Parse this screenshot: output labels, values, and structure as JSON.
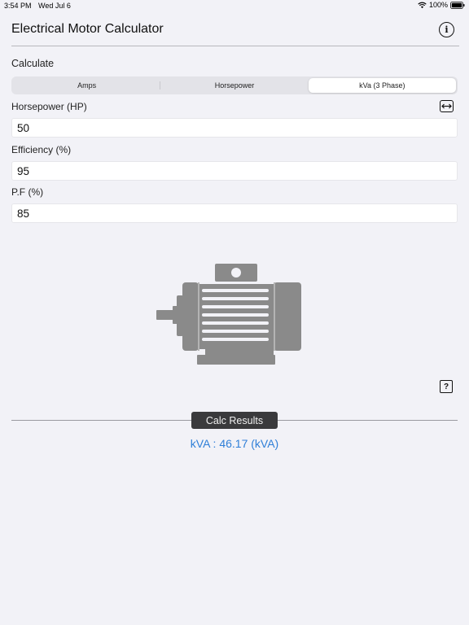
{
  "status_bar": {
    "time": "3:54 PM",
    "date": "Wed Jul 6",
    "battery": "100%"
  },
  "nav": {
    "title": "Electrical Motor Calculator",
    "info_icon": "info-circle-icon"
  },
  "calculate": {
    "label": "Calculate",
    "segments": [
      {
        "label": "Amps",
        "selected": false
      },
      {
        "label": "Horsepower",
        "selected": false
      },
      {
        "label": "kVa (3 Phase)",
        "selected": true
      }
    ]
  },
  "fields": {
    "horsepower": {
      "label": "Horsepower (HP)",
      "value": "50"
    },
    "efficiency": {
      "label": "Efficiency (%)",
      "value": "95"
    },
    "pf": {
      "label": "P.F (%)",
      "value": "85"
    }
  },
  "icons": {
    "swap": "swap-horizontal-icon",
    "help": "question-mark-icon",
    "motor": "electric-motor-icon"
  },
  "help_glyph": "?",
  "results": {
    "header": "Calc Results",
    "value_text": "kVA : 46.17 (kVA)"
  },
  "colors": {
    "background": "#f2f2f7",
    "result_text": "#2f7fd8",
    "results_header_bg": "#3a3a3c",
    "motor_gray": "#8a8a8a"
  }
}
